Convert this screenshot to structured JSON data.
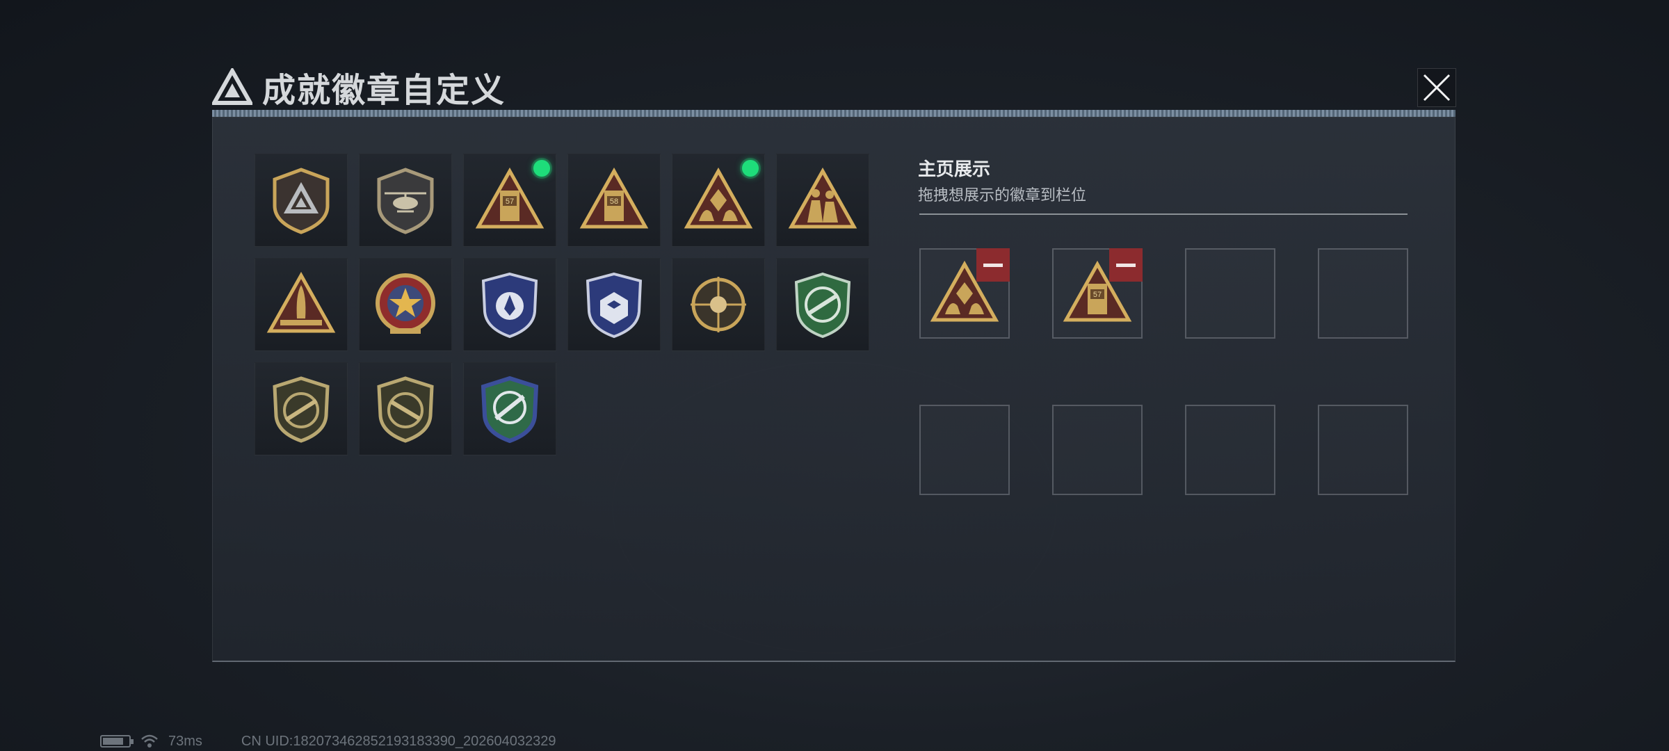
{
  "header": {
    "title": "成就徽章自定义"
  },
  "badges": [
    {
      "icon": "shield-logo-badge-icon",
      "new": false
    },
    {
      "icon": "helicopter-shield-badge-icon",
      "new": false
    },
    {
      "icon": "triangle-57-badge-icon",
      "new": true,
      "label": "57"
    },
    {
      "icon": "triangle-58-badge-icon",
      "new": false,
      "label": "58"
    },
    {
      "icon": "triangle-hands-badge-icon",
      "new": true
    },
    {
      "icon": "triangle-soldiers-badge-icon",
      "new": false
    },
    {
      "icon": "triangle-rocket-badge-icon",
      "new": false
    },
    {
      "icon": "star-medal-badge-icon",
      "new": false
    },
    {
      "icon": "blue-shield-badge-icon",
      "new": false
    },
    {
      "icon": "blue-shield-dice-badge-icon",
      "new": false
    },
    {
      "icon": "skull-target-badge-icon",
      "new": false
    },
    {
      "icon": "green-shield-rifle-badge-icon",
      "new": false
    },
    {
      "icon": "olive-shield-rifle-badge-icon",
      "new": false
    },
    {
      "icon": "olive-shield-rifle-alt-badge-icon",
      "new": false
    },
    {
      "icon": "green-blue-shield-rocket-badge-icon",
      "new": false
    }
  ],
  "showcase": {
    "title": "主页展示",
    "subtitle": "拖拽想展示的徽章到栏位",
    "slots": [
      {
        "badge": "triangle-hands-badge-icon",
        "removable": true
      },
      {
        "badge": "triangle-57-badge-icon",
        "removable": true,
        "label": "57"
      },
      {
        "badge": null
      },
      {
        "badge": null
      },
      {
        "badge": null
      },
      {
        "badge": null
      },
      {
        "badge": null
      },
      {
        "badge": null
      }
    ]
  },
  "status": {
    "ping": "73ms",
    "uid": "CN UID:1820734628521931833​90_202604032329"
  },
  "colors": {
    "accent_new": "#1edd7a",
    "remove": "#8c2b2e",
    "gold": "#c9a55a"
  }
}
